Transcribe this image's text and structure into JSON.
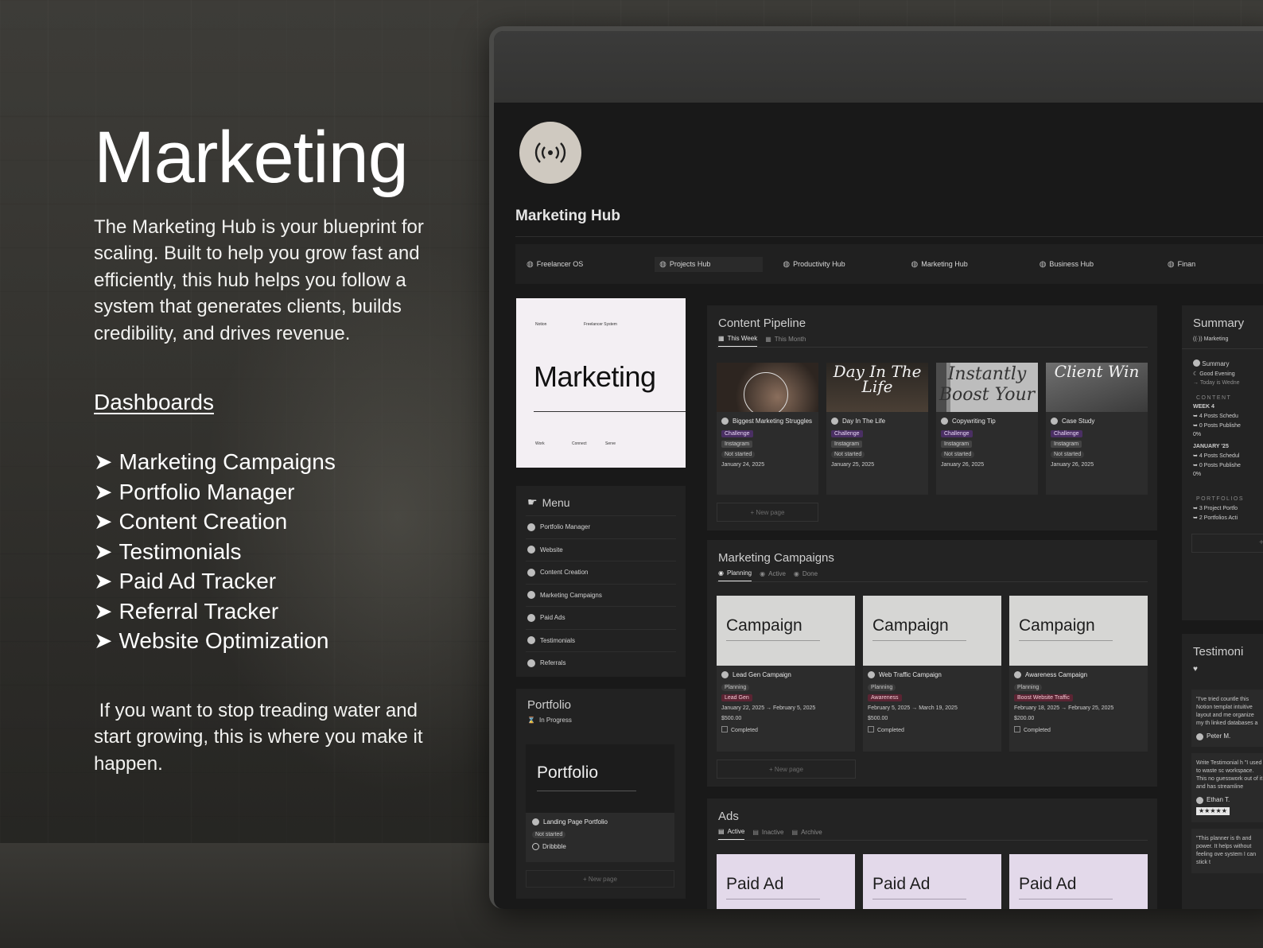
{
  "hero": {
    "title": "Marketing",
    "description": "The Marketing Hub is your blueprint for scaling. Built to help you grow fast and efficiently, this hub helps you follow a system that generates clients, builds credibility, and drives revenue.",
    "dashboards_heading": "Dashboards",
    "arrow": "➤",
    "dashboards": [
      "Marketing Campaigns",
      "Portfolio Manager",
      "Content Creation",
      "Testimonials",
      "Paid Ad Tracker",
      "Referral Tracker",
      "Website Optimization"
    ],
    "closing": "If you want to stop treading water and start growing, this is where you make it happen."
  },
  "app": {
    "page_icon": "broadcast-icon",
    "page_title": "Marketing Hub",
    "nav": [
      "Freelancer OS",
      "Projects Hub",
      "Productivity Hub",
      "Marketing Hub",
      "Business Hub",
      "Finan"
    ],
    "nav_active_index": 1,
    "cover": {
      "top_left": "Notion",
      "top_mid": "Freelancer System",
      "title": "Marketing",
      "bottom": [
        "Work",
        "Connect",
        "Serve"
      ]
    },
    "menu": {
      "title": "Menu",
      "items": [
        "Portfolio Manager",
        "Website",
        "Content Creation",
        "Marketing Campaigns",
        "Paid Ads",
        "Testimonials",
        "Referrals"
      ]
    },
    "portfolio": {
      "title": "Portfolio",
      "view": "In Progress",
      "card_thumb": "Portfolio",
      "card_name": "Landing Page Portfolio",
      "status": "Not started",
      "platform": "Dribbble",
      "new_page": "+ New page"
    },
    "content_pipeline": {
      "title": "Content Pipeline",
      "tabs": [
        "This Week",
        "This Month"
      ],
      "cards": [
        {
          "thumb": "",
          "name": "Biggest Marketing Struggles",
          "type": "Challenge",
          "platform": "Instagram",
          "status": "Not started",
          "date": "January 24, 2025"
        },
        {
          "thumb": "Day In The Life",
          "name": "Day In The Life",
          "type": "Challenge",
          "platform": "Instagram",
          "status": "Not started",
          "date": "January 25, 2025"
        },
        {
          "thumb": "Instantly Boost Your",
          "name": "Copywriting Tip",
          "type": "Challenge",
          "platform": "Instagram",
          "status": "Not started",
          "date": "January 26, 2025"
        },
        {
          "thumb": "Client Win",
          "name": "Case Study",
          "type": "Challenge",
          "platform": "Instagram",
          "status": "Not started",
          "date": "January 26, 2025"
        }
      ],
      "new_page": "+ New page"
    },
    "campaigns": {
      "title": "Marketing Campaigns",
      "tabs": [
        "Planning",
        "Active",
        "Done"
      ],
      "cards": [
        {
          "thumb": "Campaign",
          "name": "Lead Gen Campaign",
          "status": "Planning",
          "goal": "Lead Gen",
          "dates": "January 22, 2025 → February 5, 2025",
          "budget": "$500.00",
          "check": "Completed"
        },
        {
          "thumb": "Campaign",
          "name": "Web Traffic Campaign",
          "status": "Planning",
          "goal": "Awareness",
          "dates": "February 5, 2025 → March 19, 2025",
          "budget": "$500.00",
          "check": "Completed"
        },
        {
          "thumb": "Campaign",
          "name": "Awareness Campaign",
          "status": "Planning",
          "goal": "Boost Website Traffic",
          "dates": "February 18, 2025 → February 25, 2025",
          "budget": "$200.00",
          "check": "Completed"
        }
      ],
      "new_page": "+ New page"
    },
    "ads": {
      "title": "Ads",
      "tabs": [
        "Active",
        "Inactive",
        "Archive"
      ],
      "cards": [
        "Paid Ad",
        "Paid Ad",
        "Paid Ad"
      ]
    },
    "summary": {
      "title": "Summary",
      "tab": "Marketing",
      "heading": "Summary",
      "greeting": "Good Evening",
      "today": "→ Today is Wedne",
      "content_label": "CONTENT",
      "week": "WEEK 4",
      "week_scheduled": "4 Posts Schedu",
      "week_published": "0 Posts Publishe",
      "week_pct": "0%",
      "month": "JANUARY '25",
      "month_scheduled": "4 Posts Schedul",
      "month_published": "0 Posts Publishe",
      "month_pct": "0%",
      "portfolio_label": "PORTFOLIOS",
      "portfolio_1": "3 Project Portfo",
      "portfolio_2": "2 Portfolios Acti"
    },
    "testimonials": {
      "title": "Testimoni",
      "cards": [
        {
          "quote": "\"I've tried countle this Notion templat intuitive layout and me organize my th linked databases a",
          "author": "Peter M."
        },
        {
          "quote": "Write Testimonial h \"I used to waste sc workspace. This no guesswork out of it and has streamline",
          "author": "Ethan T.",
          "stars": "★★★★★"
        },
        {
          "quote": "\"This planner is th and power. It helps without feeling ove system I can stick t",
          "author": ""
        }
      ]
    }
  }
}
